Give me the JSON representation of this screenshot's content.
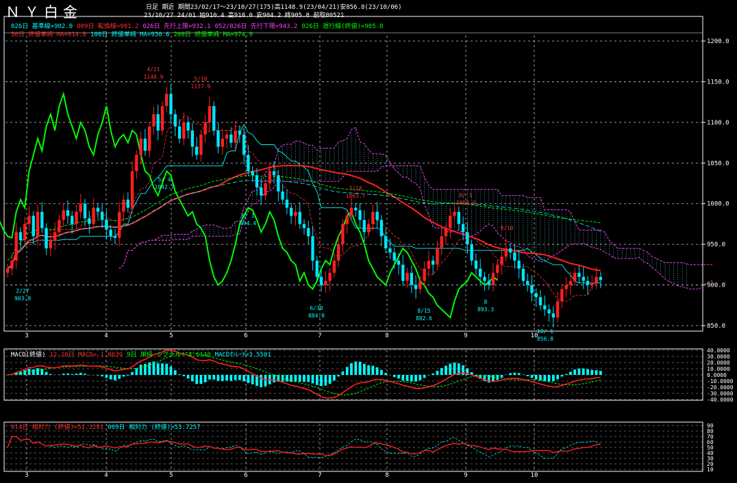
{
  "header": {
    "title": "ＮＹ白金",
    "line1": "日足  期近  期間23/02/17～23/10/27(175)高1148.9(23/04/21)安856.8(23/10/06)",
    "line2": "23/10/27 24/01 始910.4 高918.0 安904.2 終905.8 前取80521"
  },
  "legend_ichimoku": [
    {
      "text": "026日 基準線=902.0",
      "color": "#00ffff"
    },
    {
      "text": "009日 転換線=901.2",
      "color": "#ff3030"
    },
    {
      "text": "026日 先行上限=932.1",
      "color": "#ff40ff"
    },
    {
      "text": "052/026日 先行下限=943.2",
      "color": "#ff40ff"
    },
    {
      "text": "026日 遅行線(終値)=905.8",
      "color": "#00ff00"
    }
  ],
  "legend_ma": [
    {
      "text": "50日 終値単純 MA=914.8",
      "color": "#ff3030"
    },
    {
      "text": "100日 終値単純 MA=930.6",
      "color": "#00ffff"
    },
    {
      "text": "200日 終値単純 MA=974.9",
      "color": "#00ff00"
    }
  ],
  "macd_legend": [
    {
      "text": "MACD(終値)",
      "color": "#ffffff"
    },
    {
      "text": "12-26日 MACD=-1.0639",
      "color": "#ff3030"
    },
    {
      "text": "9日 単純 シグナル=-4.6140",
      "color": "#00ff00"
    },
    {
      "text": "MACDｵｼﾚｰﾀ=3.5501",
      "color": "#00ffff"
    }
  ],
  "rsi_legend": [
    {
      "text": "014日 相対力 (終値)=51.3281",
      "color": "#ff3030"
    },
    {
      "text": "009日 相対力 (終値)=53.7257",
      "color": "#00ffff"
    }
  ],
  "month_labels": [
    "3",
    "4",
    "5",
    "6",
    "7",
    "8",
    "9",
    "10"
  ],
  "price_axis": [
    "1200.0",
    "1150.0",
    "1100.0",
    "1050.0",
    "1000.0",
    "950.0",
    "900.0",
    "850.0"
  ],
  "macd_axis": [
    "40.0000",
    "30.0000",
    "20.0000",
    "10.0000",
    "0.0000",
    "-10.0000",
    "-20.0000",
    "-30.0000",
    "-40.0000"
  ],
  "rsi_axis": [
    "90",
    "80",
    "70",
    "60",
    "50",
    "40",
    "30",
    "20",
    "10"
  ],
  "annotations": [
    {
      "date": "2/27",
      "value": "903.9",
      "color": "#00ffff"
    },
    {
      "date": "4/21",
      "value": "1148.9",
      "color": "#ff3030"
    },
    {
      "date": "5/10",
      "value": "1137.9",
      "color": "#ff3030"
    },
    {
      "date": "5/ 4",
      "value": "1042.7",
      "color": "#00ffff"
    },
    {
      "date": "6/ 1",
      "value": "994.4",
      "color": "#00ffff"
    },
    {
      "date": "6/30",
      "value": "884.0",
      "color": "#00ffff"
    },
    {
      "date": "7/18",
      "value": "1003.7",
      "color": "#ff3030"
    },
    {
      "date": "8/15",
      "value": "882.6",
      "color": "#00ffff"
    },
    {
      "date": "8/ 1",
      "value": "1000.0",
      "color": "#ff3030"
    },
    {
      "date": "8",
      "value": "893.3",
      "color": "#00ffff"
    },
    {
      "date": "9/10",
      "value": "",
      "color": "#ff3030"
    },
    {
      "date": "10/ 6",
      "value": "856.8",
      "color": "#00ffff"
    }
  ],
  "chart_data": [
    {
      "type": "candlestick",
      "title": "ＮＹ白金",
      "ylim": [
        850,
        1200
      ],
      "x_months": [
        "3",
        "4",
        "5",
        "6",
        "7",
        "8",
        "9",
        "10"
      ],
      "closes": [
        920,
        930,
        965,
        955,
        975,
        985,
        960,
        990,
        970,
        945,
        955,
        965,
        980,
        992,
        985,
        975,
        990,
        1000,
        982,
        975,
        995,
        990,
        980,
        968,
        960,
        958,
        990,
        1005,
        995,
        1040,
        1060,
        1080,
        1065,
        1095,
        1110,
        1090,
        1120,
        1135,
        1110,
        1095,
        1080,
        1100,
        1090,
        1070,
        1060,
        1085,
        1100,
        1120,
        1090,
        1070,
        1080,
        1085,
        1075,
        1090,
        1085,
        1060,
        1040,
        1035,
        1020,
        1010,
        1025,
        1040,
        1035,
        1015,
        1005,
        995,
        985,
        990,
        975,
        970,
        960,
        930,
        910,
        900,
        905,
        915,
        930,
        950,
        975,
        985,
        995,
        992,
        980,
        965,
        975,
        990,
        980,
        960,
        945,
        940,
        930,
        925,
        905,
        915,
        900,
        895,
        905,
        920,
        930,
        925,
        945,
        960,
        970,
        985,
        990,
        975,
        965,
        950,
        930,
        920,
        910,
        905,
        900,
        915,
        925,
        935,
        945,
        940,
        930,
        920,
        905,
        900,
        890,
        885,
        875,
        870,
        865,
        860,
        880,
        895,
        900,
        905,
        915,
        910,
        905,
        900,
        903,
        910,
        906
      ],
      "ichimoku_lines": [
        "基準線",
        "転換線",
        "先行上限",
        "先行下限",
        "遅行線"
      ],
      "moving_averages": [
        {
          "name": "50日 終値単純",
          "last": 914.8
        },
        {
          "name": "100日 終値単純",
          "last": 930.6
        },
        {
          "name": "200日 終値単純",
          "last": 974.9
        }
      ]
    },
    {
      "type": "line",
      "title": "MACD(終値)",
      "ylim": [
        -40,
        40
      ],
      "series": [
        {
          "name": "12-26日 MACD",
          "last": -1.0639
        },
        {
          "name": "9日 単純 シグナル",
          "last": -4.614
        },
        {
          "name": "MACDｵｼﾚｰﾀ",
          "last": 3.5501
        }
      ]
    },
    {
      "type": "line",
      "title": "相対力",
      "ylim": [
        10,
        90
      ],
      "series": [
        {
          "name": "014日 相対力 (終値)",
          "last": 51.3281
        },
        {
          "name": "009日 相対力 (終値)",
          "last": 53.7257
        }
      ]
    }
  ]
}
